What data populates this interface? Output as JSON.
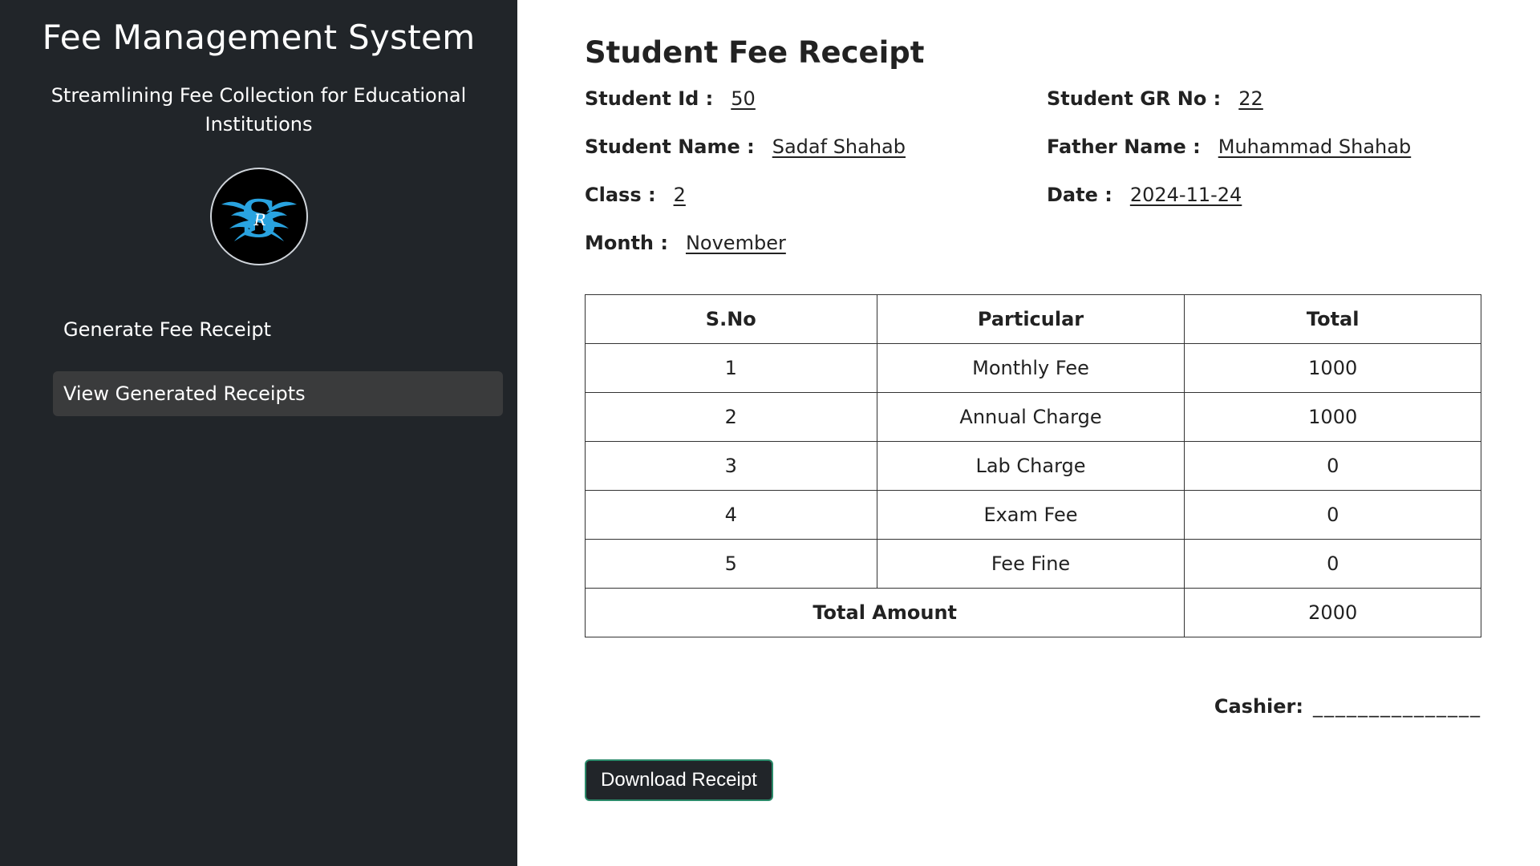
{
  "sidebar": {
    "title": "Fee Management System",
    "subtitle": "Streamlining Fee Collection for Educational Institutions",
    "logo_letter": "S",
    "logo_monogram": "R",
    "items": [
      {
        "label": "Generate Fee Receipt",
        "active": false
      },
      {
        "label": "View Generated Receipts",
        "active": true
      }
    ]
  },
  "receipt": {
    "title": "Student Fee Receipt",
    "fields": {
      "student_id": {
        "label": "Student Id :",
        "value": "50"
      },
      "student_gr_no": {
        "label": "Student GR No :",
        "value": "22"
      },
      "student_name": {
        "label": "Student Name :",
        "value": "Sadaf Shahab"
      },
      "father_name": {
        "label": "Father Name :",
        "value": "Muhammad Shahab"
      },
      "class": {
        "label": "Class :",
        "value": "2"
      },
      "date": {
        "label": "Date :",
        "value": "2024-11-24"
      },
      "month": {
        "label": "Month :",
        "value": "November"
      }
    },
    "table": {
      "headers": [
        "S.No",
        "Particular",
        "Total"
      ],
      "rows": [
        {
          "sno": "1",
          "particular": "Monthly Fee",
          "total": "1000"
        },
        {
          "sno": "2",
          "particular": "Annual Charge",
          "total": "1000"
        },
        {
          "sno": "3",
          "particular": "Lab Charge",
          "total": "0"
        },
        {
          "sno": "4",
          "particular": "Exam Fee",
          "total": "0"
        },
        {
          "sno": "5",
          "particular": "Fee Fine",
          "total": "0"
        }
      ],
      "total_label": "Total Amount",
      "total_value": "2000"
    },
    "cashier_label": "Cashier:",
    "cashier_line": "_______________",
    "download_label": "Download Receipt"
  },
  "colors": {
    "sidebar_bg": "#212529",
    "active_item_bg": "#3a3b3c",
    "logo_accent": "#29a3e0",
    "button_border": "#2b8a6a"
  }
}
